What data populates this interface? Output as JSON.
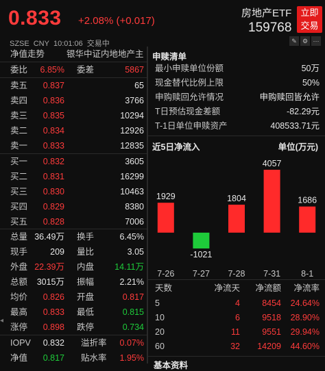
{
  "header": {
    "price": "0.833",
    "change": "+2.08% (+0.017)",
    "etf_name": "房地产ETF",
    "code": "159768",
    "buy_btn": [
      "立即",
      "交易"
    ],
    "exchange": "SZSE",
    "currency": "CNY",
    "time": "10:01:06",
    "status": "交易中"
  },
  "left": {
    "nav_label": "净值走势",
    "fund_name": "银华中证内地地产主",
    "ratio_row": {
      "k1": "委比",
      "v1": "6.85%",
      "k2": "委差",
      "v2": "5867"
    },
    "asks": [
      {
        "label": "卖五",
        "price": "0.837",
        "vol": "65"
      },
      {
        "label": "卖四",
        "price": "0.836",
        "vol": "3766"
      },
      {
        "label": "卖三",
        "price": "0.835",
        "vol": "10294"
      },
      {
        "label": "卖二",
        "price": "0.834",
        "vol": "12926"
      },
      {
        "label": "卖一",
        "price": "0.833",
        "vol": "12835"
      }
    ],
    "bids": [
      {
        "label": "买一",
        "price": "0.832",
        "vol": "3605"
      },
      {
        "label": "买二",
        "price": "0.831",
        "vol": "16299"
      },
      {
        "label": "买三",
        "price": "0.830",
        "vol": "10463"
      },
      {
        "label": "买四",
        "price": "0.829",
        "vol": "8380"
      },
      {
        "label": "买五",
        "price": "0.828",
        "vol": "7006"
      }
    ],
    "stats": [
      {
        "k1": "总量",
        "v1": "36.49万",
        "c1": "white",
        "k2": "换手",
        "v2": "6.45%",
        "c2": "white"
      },
      {
        "k1": "现手",
        "v1": "209",
        "c1": "white",
        "k2": "量比",
        "v2": "3.05",
        "c2": "white"
      },
      {
        "k1": "外盘",
        "v1": "22.39万",
        "c1": "red",
        "k2": "内盘",
        "v2": "14.11万",
        "c2": "green"
      },
      {
        "k1": "总额",
        "v1": "3015万",
        "c1": "white",
        "k2": "振幅",
        "v2": "2.21%",
        "c2": "white"
      },
      {
        "k1": "均价",
        "v1": "0.826",
        "c1": "red",
        "k2": "开盘",
        "v2": "0.817",
        "c2": "red"
      },
      {
        "k1": "最高",
        "v1": "0.833",
        "c1": "red",
        "k2": "最低",
        "v2": "0.815",
        "c2": "green"
      },
      {
        "k1": "涨停",
        "v1": "0.898",
        "c1": "red",
        "k2": "跌停",
        "v2": "0.734",
        "c2": "green"
      }
    ],
    "stats2": [
      {
        "k1": "IOPV",
        "v1": "0.832",
        "c1": "white",
        "k2": "溢折率",
        "v2": "0.07%",
        "c2": "red"
      },
      {
        "k1": "净值",
        "v1": "0.817",
        "c1": "green",
        "k2": "贴水率",
        "v2": "1.95%",
        "c2": "red"
      }
    ]
  },
  "right": {
    "subscription": {
      "title": "申赎清单",
      "rows": [
        {
          "k": "最小申赎单位份额",
          "v": "50万"
        },
        {
          "k": "现金替代比例上限",
          "v": "50%"
        },
        {
          "k": "申购赎回允许情况",
          "v": "申购赎回皆允许"
        },
        {
          "k": "T日预估现金差额",
          "v": "-82.29元"
        },
        {
          "k": "T-1日单位申赎资产",
          "v": "408533.71元"
        }
      ]
    },
    "flow": {
      "title": "近5日净流入",
      "unit": "单位(万元)"
    },
    "table": {
      "headers": [
        "天数",
        "净流天",
        "净流额",
        "净流率"
      ],
      "rows": [
        {
          "days": "5",
          "count": "4",
          "amount": "8454",
          "rate": "24.64%"
        },
        {
          "days": "10",
          "count": "6",
          "amount": "9518",
          "rate": "28.90%"
        },
        {
          "days": "20",
          "count": "11",
          "amount": "9551",
          "rate": "29.94%"
        },
        {
          "days": "60",
          "count": "32",
          "amount": "14209",
          "rate": "44.60%"
        }
      ]
    },
    "footer": "基本资料"
  },
  "chart_data": {
    "type": "bar",
    "title": "近5日净流入",
    "ylabel": "单位(万元)",
    "categories": [
      "7-26",
      "7-27",
      "7-28",
      "7-31",
      "8-1"
    ],
    "values": [
      1929,
      -1021,
      1804,
      4057,
      1686
    ],
    "colors": {
      "positive": "#ff2a2a",
      "negative": "#1ecb3a"
    }
  },
  "colors": {
    "up": "#ff3b3b",
    "down": "#1ecb3a",
    "accent": "#e31b1b",
    "background": "#0f0f0f"
  }
}
